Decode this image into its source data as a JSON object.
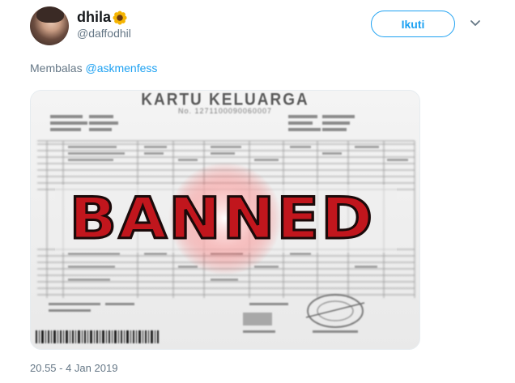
{
  "tweet": {
    "display_name": "dhila",
    "name_emoji_icon": "sunflower-icon",
    "handle": "@daffodhil",
    "follow_label": "Ikuti",
    "reply_prefix": "Membalas",
    "reply_mention": "@askmenfess",
    "timestamp": "20.55 - 4 Jan 2019"
  },
  "media": {
    "card_title": "KARTU KELUARGA",
    "card_number": "No. 1271100090060007",
    "overlay_text": "BANNED"
  },
  "colors": {
    "accent": "#1da1f2",
    "secondary_text": "#657786",
    "banned_red": "#c1161d"
  }
}
